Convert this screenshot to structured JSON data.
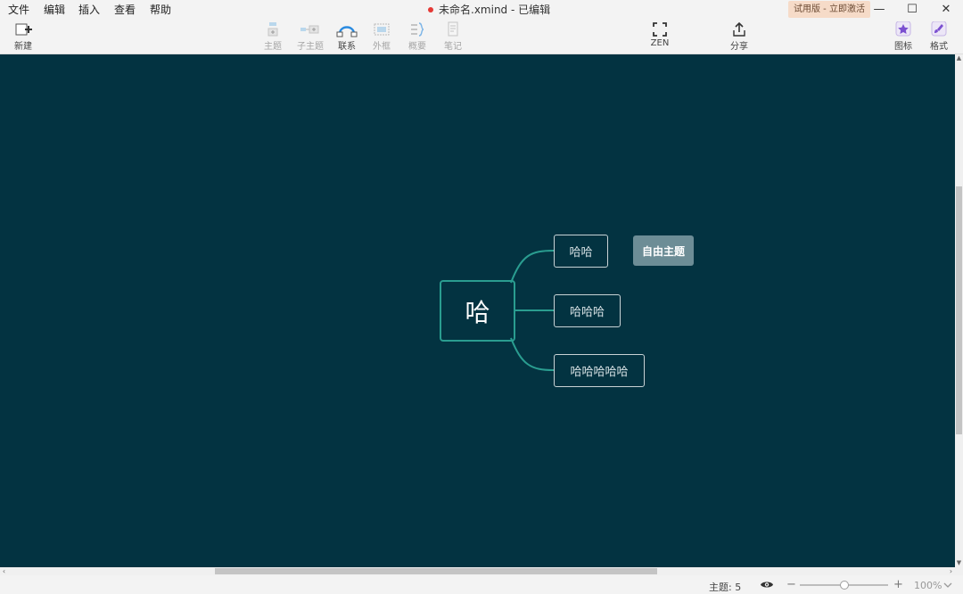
{
  "menu": [
    "文件",
    "编辑",
    "插入",
    "查看",
    "帮助"
  ],
  "window": {
    "title": "未命名.xmind - 已编辑",
    "trial_label": "试用版 - 立即激活",
    "minimize": "—",
    "maximize": "☐",
    "close": "✕"
  },
  "toolbar": {
    "new": "新建",
    "topic": "主题",
    "subtopic": "子主题",
    "relationship": "联系",
    "boundary": "外框",
    "summary": "概要",
    "notes": "笔记",
    "zen": "ZEN",
    "share": "分享",
    "icons": "图标",
    "format": "格式"
  },
  "mindmap": {
    "central_topic": "哈",
    "branches": [
      "哈哈",
      "哈哈哈",
      "哈哈哈哈哈"
    ],
    "floating_topic": "自由主题"
  },
  "status": {
    "topic_count_label": "主题: 5",
    "zoom_minus": "−",
    "zoom_plus": "+",
    "zoom_level": "100%"
  },
  "colors": {
    "canvas_bg": "#033341",
    "connector": "#2a9d90",
    "floating_bg": "#6d8d96",
    "trial_bg": "#f6dbc8"
  }
}
